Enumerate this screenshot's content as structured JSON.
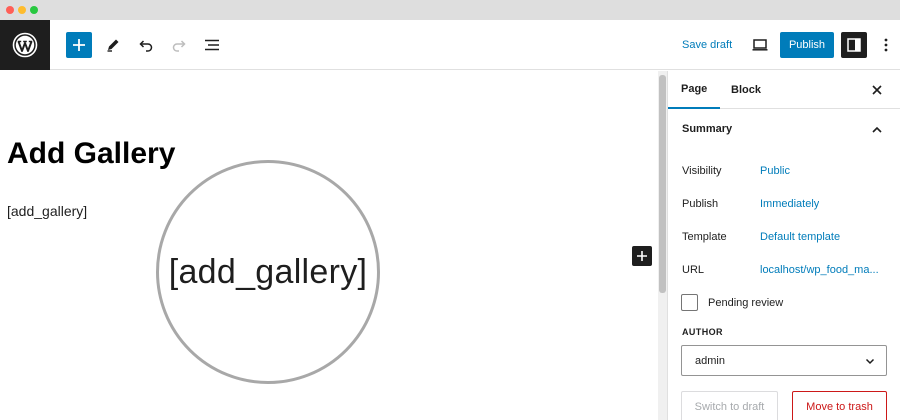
{
  "header": {
    "add_label": "+",
    "save_draft": "Save draft",
    "publish": "Publish"
  },
  "editor": {
    "title": "Add Gallery",
    "shortcode": "[add_gallery]",
    "magnified_text": "[add_gallery]"
  },
  "sidebar": {
    "tabs": [
      {
        "label": "Page",
        "active": true
      },
      {
        "label": "Block",
        "active": false
      }
    ],
    "summary": {
      "title": "Summary",
      "rows": [
        {
          "label": "Visibility",
          "value": "Public"
        },
        {
          "label": "Publish",
          "value": "Immediately"
        },
        {
          "label": "Template",
          "value": "Default template"
        },
        {
          "label": "URL",
          "value": "localhost/wp_food_ma..."
        }
      ],
      "pending_review": "Pending review",
      "author_label": "AUTHOR",
      "author_value": "admin",
      "switch_draft": "Switch to draft",
      "move_to_trash": "Move to trash"
    }
  },
  "colors": {
    "accent": "#007cba",
    "dark": "#1e1e1e",
    "danger": "#cc1818"
  },
  "icons": [
    "wordpress-logo-icon",
    "plus-icon",
    "pencil-icon",
    "undo-icon",
    "redo-icon",
    "list-view-icon",
    "desktop-preview-icon",
    "settings-sidebar-icon",
    "more-options-icon",
    "close-icon",
    "chevron-up-icon",
    "chevron-down-icon"
  ]
}
